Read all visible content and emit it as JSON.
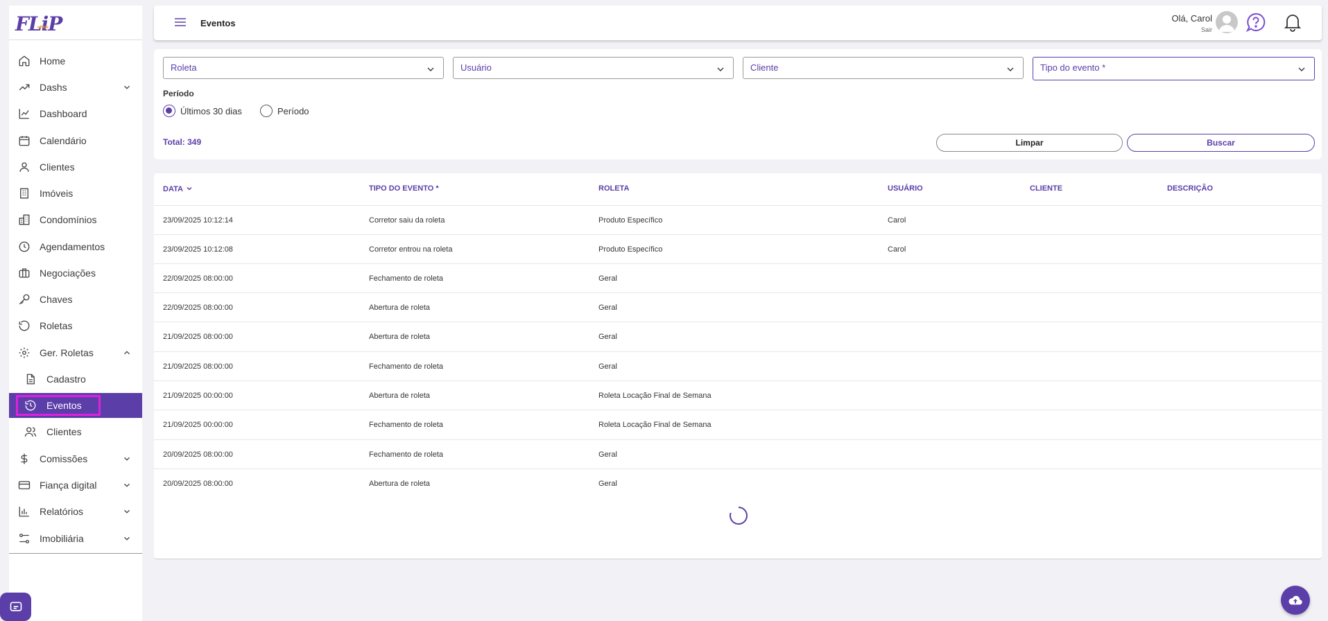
{
  "header": {
    "title": "Eventos",
    "greeting": "Olá, Carol",
    "logout": "Sair"
  },
  "logo": {
    "text": "FLiP",
    "sub": "office"
  },
  "sidebar": {
    "items": [
      {
        "label": "Home",
        "icon": "home-icon"
      },
      {
        "label": "Dashs",
        "icon": "trending-up-icon"
      },
      {
        "label": "Dashboard",
        "icon": "chart-line-icon"
      },
      {
        "label": "Calendário",
        "icon": "calendar-icon"
      },
      {
        "label": "Clientes",
        "icon": "user-icon"
      },
      {
        "label": "Imóveis",
        "icon": "building-icon"
      },
      {
        "label": "Condomínios",
        "icon": "buildings-icon"
      },
      {
        "label": "Agendamentos",
        "icon": "clock-icon"
      },
      {
        "label": "Negociações",
        "icon": "briefcase-icon"
      },
      {
        "label": "Chaves",
        "icon": "key-icon"
      },
      {
        "label": "Roletas",
        "icon": "rotate-icon"
      },
      {
        "label": "Ger. Roletas",
        "icon": "gear-icon"
      },
      {
        "label": "Cadastro",
        "icon": "document-icon"
      },
      {
        "label": "Eventos",
        "icon": "history-icon"
      },
      {
        "label": "Clientes",
        "icon": "users-icon"
      },
      {
        "label": "Comissões",
        "icon": "dollar-icon"
      },
      {
        "label": "Fiança digital",
        "icon": "card-icon"
      },
      {
        "label": "Relatórios",
        "icon": "bar-chart-icon"
      },
      {
        "label": "Imobiliária",
        "icon": "sliders-icon"
      }
    ]
  },
  "filters": {
    "roleta": "Roleta",
    "usuario": "Usuário",
    "cliente": "Cliente",
    "tipo_evento": "Tipo do evento *",
    "periodo_label": "Período",
    "radio_30": "Últimos 30 dias",
    "radio_periodo": "Período",
    "total": "Total: 349",
    "btn_clear": "Limpar",
    "btn_search": "Buscar"
  },
  "table": {
    "columns": [
      "DATA",
      "TIPO DO EVENTO *",
      "ROLETA",
      "USUÁRIO",
      "CLIENTE",
      "DESCRIÇÃO"
    ],
    "rows": [
      [
        "23/09/2025 10:12:14",
        "Corretor saiu da roleta",
        "Produto Específico",
        "Carol",
        "",
        ""
      ],
      [
        "23/09/2025 10:12:08",
        "Corretor entrou na roleta",
        "Produto Específico",
        "Carol",
        "",
        ""
      ],
      [
        "22/09/2025 08:00:00",
        "Fechamento de roleta",
        "Geral",
        "",
        "",
        ""
      ],
      [
        "22/09/2025 08:00:00",
        "Abertura de roleta",
        "Geral",
        "",
        "",
        ""
      ],
      [
        "21/09/2025 08:00:00",
        "Abertura de roleta",
        "Geral",
        "",
        "",
        ""
      ],
      [
        "21/09/2025 08:00:00",
        "Fechamento de roleta",
        "Geral",
        "",
        "",
        ""
      ],
      [
        "21/09/2025 00:00:00",
        "Abertura de roleta",
        "Roleta Locação Final de Semana",
        "",
        "",
        ""
      ],
      [
        "21/09/2025 00:00:00",
        "Fechamento de roleta",
        "Roleta Locação Final de Semana",
        "",
        "",
        ""
      ],
      [
        "20/09/2025 08:00:00",
        "Fechamento de roleta",
        "Geral",
        "",
        "",
        ""
      ],
      [
        "20/09/2025 08:00:00",
        "Abertura de roleta",
        "Geral",
        "",
        "",
        ""
      ]
    ]
  },
  "colors": {
    "accent": "#5b3ea8",
    "highlight": "#e020e0"
  }
}
